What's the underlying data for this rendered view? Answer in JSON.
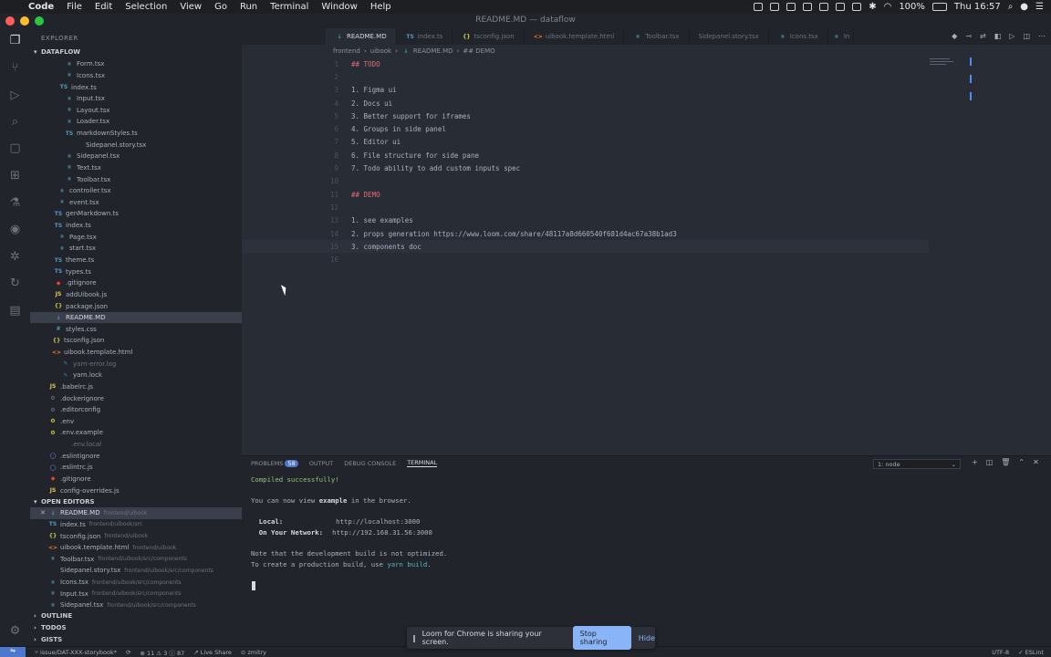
{
  "menubar": {
    "app": "Code",
    "items": [
      "File",
      "Edit",
      "Selection",
      "View",
      "Go",
      "Run",
      "Terminal",
      "Window",
      "Help"
    ],
    "battery": "100%",
    "clock": "Thu 16:57"
  },
  "window": {
    "title": "README.MD — dataflow"
  },
  "sidebar": {
    "header": "EXPLORER",
    "section_title": "DATAFLOW",
    "files": [
      {
        "name": "Form.tsx",
        "icon": "react"
      },
      {
        "name": "Icons.tsx",
        "icon": "react"
      },
      {
        "name": "index.ts",
        "icon": "ts",
        "label": "TS"
      },
      {
        "name": "Input.tsx",
        "icon": "react"
      },
      {
        "name": "Layout.tsx",
        "icon": "react"
      },
      {
        "name": "Loader.tsx",
        "icon": "react"
      },
      {
        "name": "markdownStyles.ts",
        "icon": "ts",
        "label": "TS"
      },
      {
        "name": "Sidepanel.story.tsx",
        "icon": "none"
      },
      {
        "name": "Sidepanel.tsx",
        "icon": "react"
      },
      {
        "name": "Text.tsx",
        "icon": "react"
      },
      {
        "name": "Toolbar.tsx",
        "icon": "react"
      },
      {
        "name": "controller.tsx",
        "icon": "react"
      },
      {
        "name": "event.tsx",
        "icon": "react"
      },
      {
        "name": "genMarkdown.ts",
        "icon": "ts",
        "label": "TS"
      },
      {
        "name": "index.ts",
        "icon": "ts",
        "label": "TS"
      },
      {
        "name": "Page.tsx",
        "icon": "react"
      },
      {
        "name": "start.tsx",
        "icon": "react"
      },
      {
        "name": "theme.ts",
        "icon": "ts",
        "label": "TS"
      },
      {
        "name": "types.ts",
        "icon": "ts",
        "label": "TS"
      },
      {
        "name": ".gitignore",
        "icon": "git"
      },
      {
        "name": "addUibook.js",
        "icon": "js",
        "label": "JS"
      },
      {
        "name": "package.json",
        "icon": "json"
      },
      {
        "name": "README.MD",
        "icon": "md"
      },
      {
        "name": "styles.css",
        "icon": "css"
      },
      {
        "name": "tsconfig.json",
        "icon": "json",
        "label": "{}"
      },
      {
        "name": "uibook.template.html",
        "icon": "html",
        "label": "<>"
      },
      {
        "name": "yarn-error.log",
        "icon": "yarn"
      },
      {
        "name": "yarn.lock",
        "icon": "yarn"
      },
      {
        "name": ".babelrc.js",
        "icon": "js",
        "label": "JS"
      },
      {
        "name": ".dockerignore",
        "icon": "gear"
      },
      {
        "name": ".editorconfig",
        "icon": "gear"
      },
      {
        "name": ".env",
        "icon": "env"
      },
      {
        "name": ".env.example",
        "icon": "env"
      },
      {
        "name": ".env.local",
        "icon": "none"
      },
      {
        "name": ".eslintignore",
        "icon": "eslint"
      },
      {
        "name": ".eslintrc.js",
        "icon": "eslint"
      },
      {
        "name": ".gitignore",
        "icon": "git"
      },
      {
        "name": "config-overrides.js",
        "icon": "js",
        "label": "JS"
      }
    ],
    "open_editors_title": "OPEN EDITORS",
    "open_editors": [
      {
        "name": "README.MD",
        "path": "frontend/uibook"
      },
      {
        "name": "index.ts",
        "path": "frontend/uibook/src"
      },
      {
        "name": "tsconfig.json",
        "path": "frontend/uibook"
      },
      {
        "name": "uibook.template.html",
        "path": "frontend/uibook"
      },
      {
        "name": "Toolbar.tsx",
        "path": "frontend/uibook/src/components"
      },
      {
        "name": "Sidepanel.story.tsx",
        "path": "frontend/uibook/src/components"
      },
      {
        "name": "Icons.tsx",
        "path": "frontend/uibook/src/components"
      },
      {
        "name": "Input.tsx",
        "path": "frontend/uibook/src/components"
      },
      {
        "name": "Sidepanel.tsx",
        "path": "frontend/uibook/src/components"
      }
    ],
    "outline": "OUTLINE",
    "todos": "TODOS",
    "gists": "GISTS"
  },
  "tabs": [
    "README.MD",
    "index.ts",
    "tsconfig.json",
    "uibook.template.html",
    "Toolbar.tsx",
    "Sidepanel.story.tsx",
    "Icons.tsx",
    "In"
  ],
  "breadcrumb": [
    "frontend",
    "uibook",
    "README.MD",
    "## DEMO"
  ],
  "editor": {
    "lines": [
      {
        "n": "1",
        "t": "## TODO"
      },
      {
        "n": "2",
        "t": ""
      },
      {
        "n": "3",
        "t": "1. Figma ui"
      },
      {
        "n": "4",
        "t": "2. Docs ui"
      },
      {
        "n": "5",
        "t": "3. Better support for iframes"
      },
      {
        "n": "6",
        "t": "4. Groups in side panel"
      },
      {
        "n": "7",
        "t": "5. Editor ui"
      },
      {
        "n": "8",
        "t": "6. File structure for side pane"
      },
      {
        "n": "9",
        "t": "7. Todo ability to add custom inputs spec"
      },
      {
        "n": "10",
        "t": ""
      },
      {
        "n": "11",
        "t": "## DEMO"
      },
      {
        "n": "12",
        "t": ""
      },
      {
        "n": "13",
        "t": "1. see examples"
      },
      {
        "n": "14",
        "t": "2. props generation https://www.loom.com/share/48117a8d660540f681d4ac67a38b1ad3"
      },
      {
        "n": "15",
        "t": "3. components doc"
      },
      {
        "n": "16",
        "t": ""
      }
    ]
  },
  "panel": {
    "tabs": [
      "PROBLEMS",
      "OUTPUT",
      "DEBUG CONSOLE",
      "TERMINAL"
    ],
    "problems_count": "58",
    "terminal_select": "1: node",
    "terminal": {
      "compiled": "Compiled successfully!",
      "view_pre": "You can now view ",
      "view_app": "example",
      "view_post": " in the browser.",
      "local_label": "  Local:",
      "local_url": "http://localhost:3000",
      "network_label": "  On Your Network:",
      "network_url": "http://192.168.31.56:3000",
      "note": "Note that the development build is not optimized.",
      "build_pre": "To create a production build, use ",
      "build_cmd": "yarn build",
      "build_post": "."
    }
  },
  "statusbar": {
    "branch": "issue/DAT-XXX-storybook*",
    "sync": "⟳",
    "problems": "⊗ 11 ⚠ 3 ⓘ 87",
    "liveshare": "Live Share",
    "user": "zmitry",
    "encoding": "UTF-8",
    "eslint": "ESLint"
  },
  "loom": {
    "message": "Loom for Chrome is sharing your screen.",
    "stop": "Stop sharing",
    "hide": "Hide"
  }
}
